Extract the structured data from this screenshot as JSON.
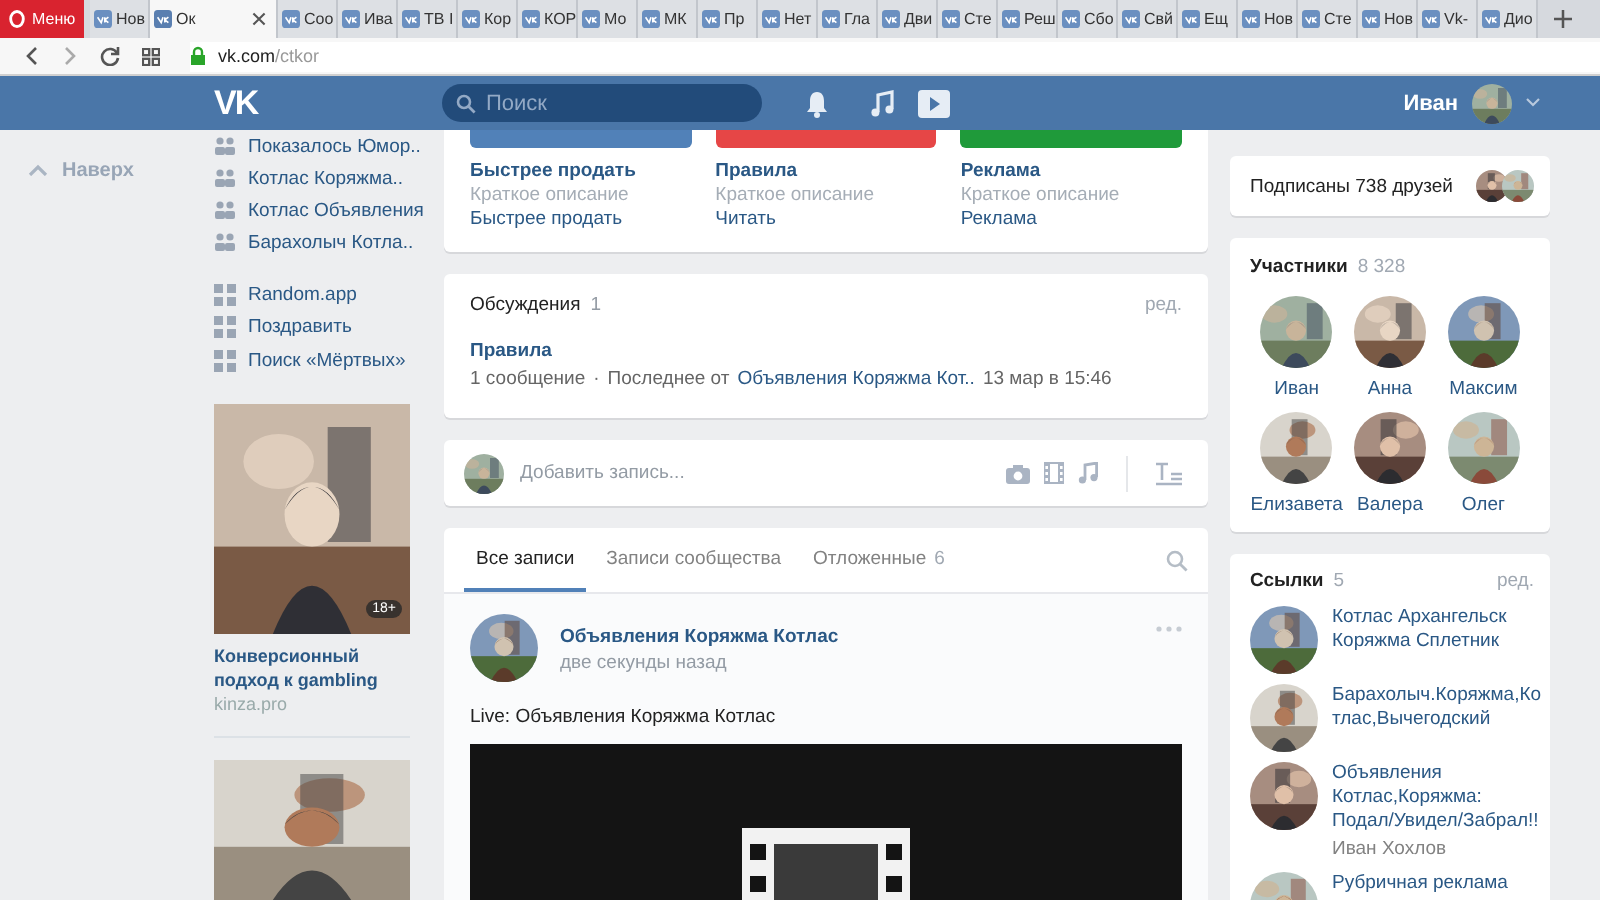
{
  "browser": {
    "menu_label": "Меню",
    "tabs": [
      {
        "label": "Нов",
        "selected": false
      },
      {
        "label": "Ок",
        "selected": true
      },
      {
        "label": "Соо",
        "selected": false
      },
      {
        "label": "Ива",
        "selected": false
      },
      {
        "label": "ТВ I",
        "selected": false
      },
      {
        "label": "Кор",
        "selected": false
      },
      {
        "label": "КОР",
        "selected": false
      },
      {
        "label": "Мо",
        "selected": false
      },
      {
        "label": "МК",
        "selected": false
      },
      {
        "label": "Пр",
        "selected": false
      },
      {
        "label": "Нет",
        "selected": false
      },
      {
        "label": "Гла",
        "selected": false
      },
      {
        "label": "Дви",
        "selected": false
      },
      {
        "label": "Сте",
        "selected": false
      },
      {
        "label": "Реш",
        "selected": false
      },
      {
        "label": "Сбо",
        "selected": false
      },
      {
        "label": "Свй",
        "selected": false
      },
      {
        "label": "Ещ",
        "selected": false
      },
      {
        "label": "Нов",
        "selected": false
      },
      {
        "label": "Сте",
        "selected": false
      },
      {
        "label": "Нов",
        "selected": false
      },
      {
        "label": "Vk-",
        "selected": false
      },
      {
        "label": "Дио",
        "selected": false
      }
    ],
    "url_host": "vk.com",
    "url_path": "/ctkor"
  },
  "header": {
    "logo": "VK",
    "search_placeholder": "Поиск",
    "user_name": "Иван"
  },
  "left": {
    "back_to_top": "Наверх",
    "menu": [
      {
        "kind": "group",
        "label": "Показалось Юмор.."
      },
      {
        "kind": "group",
        "label": "Котлас Коряжма.."
      },
      {
        "kind": "group",
        "label": "Котлас Объявления"
      },
      {
        "kind": "group",
        "label": "Барахолыч Котла.."
      },
      {
        "kind": "app",
        "label": "Random.app"
      },
      {
        "kind": "app",
        "label": "Поздравить"
      },
      {
        "kind": "app",
        "label": "Поиск «Мёртвых»"
      }
    ],
    "ad": {
      "badge": "18+",
      "title": "Конверсионный подход к gambling",
      "domain": "kinza.pro"
    }
  },
  "center": {
    "tiles": [
      {
        "color": "#5181b8",
        "title": "Быстрее продать",
        "description": "Краткое описание",
        "link": "Быстрее продать"
      },
      {
        "color": "#e64646",
        "title": "Правила",
        "description": "Краткое описание",
        "link": "Читать"
      },
      {
        "color": "#1f9a3a",
        "title": "Реклама",
        "description": "Краткое описание",
        "link": "Реклама"
      }
    ],
    "discussions": {
      "title": "Обсуждения",
      "count": "1",
      "edit": "ред.",
      "topics": [
        {
          "title": "Правила",
          "messages": "1 сообщение",
          "separator": "·",
          "last_prefix": "Последнее от",
          "last_author": "Объявления Коряжма Кот..",
          "last_time": "13 мар в 15:46"
        }
      ]
    },
    "composer": {
      "placeholder": "Добавить запись..."
    },
    "wall": {
      "tabs": [
        {
          "label": "Все записи",
          "selected": true
        },
        {
          "label": "Записи сообщества",
          "selected": false
        },
        {
          "label": "Отложенные",
          "count": "6",
          "selected": false
        }
      ],
      "post": {
        "author": "Объявления Коряжма Котлас",
        "time": "две секунды назад",
        "text": "Live: Объявления Коряжма Котлас"
      }
    }
  },
  "right": {
    "friends": {
      "text": "Подписаны 738 друзей"
    },
    "members": {
      "title": "Участники",
      "count": "8 328",
      "people": [
        {
          "name": "Иван"
        },
        {
          "name": "Анна"
        },
        {
          "name": "Максим"
        },
        {
          "name": "Елизавета"
        },
        {
          "name": "Валера"
        },
        {
          "name": "Олег"
        }
      ]
    },
    "links": {
      "title": "Ссылки",
      "count": "5",
      "edit": "ред.",
      "items": [
        {
          "title": "Котлас Архангельск Коряжма Сплетник"
        },
        {
          "title": "Барахолыч.Коряжма,Котлас,Вычегодский"
        },
        {
          "title": "Объявления Котлас,Коряжма: Подал/Увидел/Забрал!!",
          "subtitle": "Иван Хохлов"
        },
        {
          "title": "Рубричная реклама"
        }
      ]
    }
  }
}
